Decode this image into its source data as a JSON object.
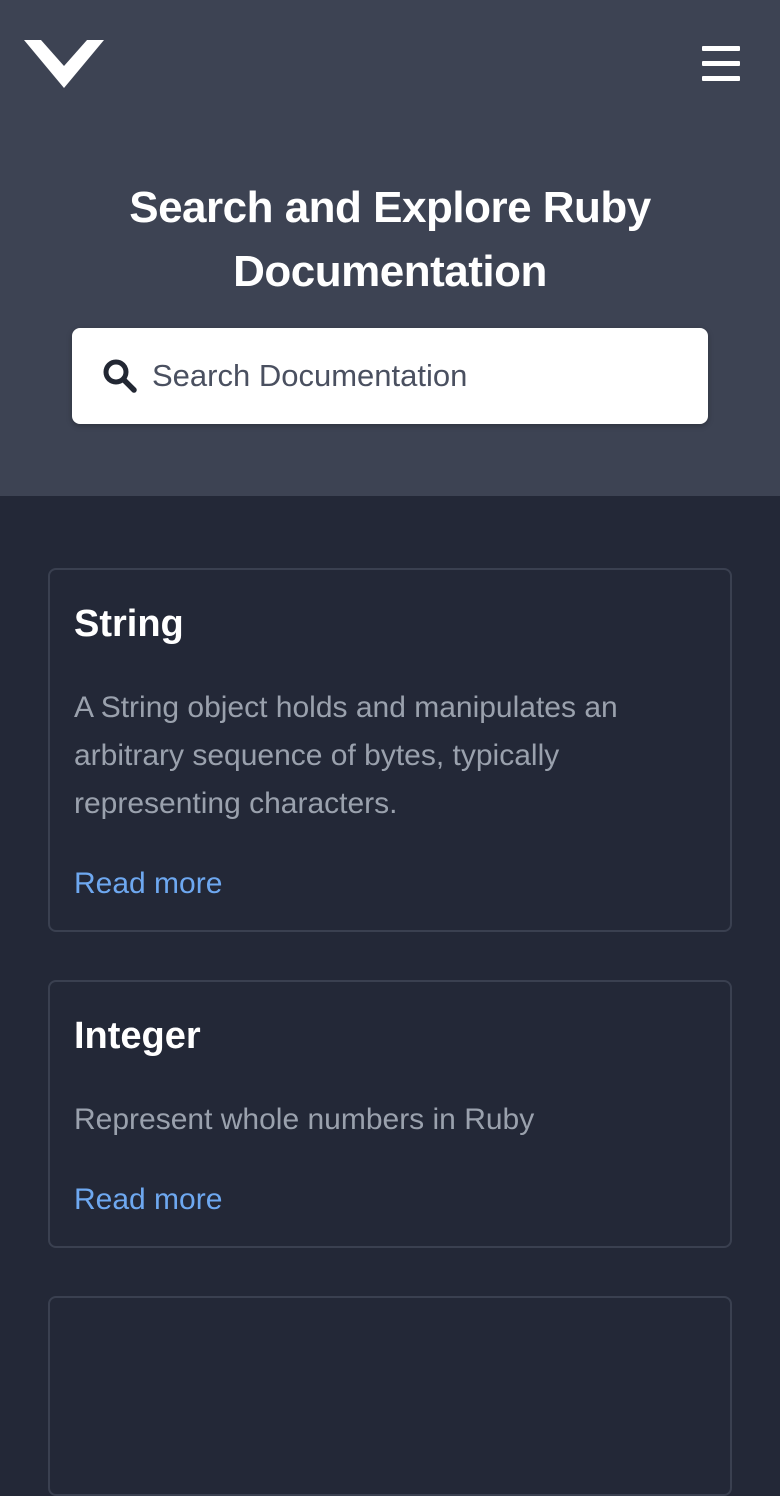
{
  "header": {
    "logo_name": "chevron-logo",
    "menu_icon": "hamburger-menu-icon"
  },
  "hero": {
    "title": "Search and Explore Ruby Documentation"
  },
  "search": {
    "icon": "search-icon",
    "placeholder": "Search Documentation",
    "value": ""
  },
  "cards": [
    {
      "title": "String",
      "description": "A String object holds and manipulates an arbitrary sequence of bytes, typically representing characters.",
      "link": "Read more"
    },
    {
      "title": "Integer",
      "description": "Represent whole numbers in Ruby",
      "link": "Read more"
    },
    {
      "title": "",
      "description": "",
      "link": ""
    }
  ],
  "colors": {
    "hero_bg": "#3d4353",
    "page_bg": "#232837",
    "card_border": "#3a4050",
    "link": "#6ea8f0",
    "muted_text": "#9aa1ad"
  }
}
